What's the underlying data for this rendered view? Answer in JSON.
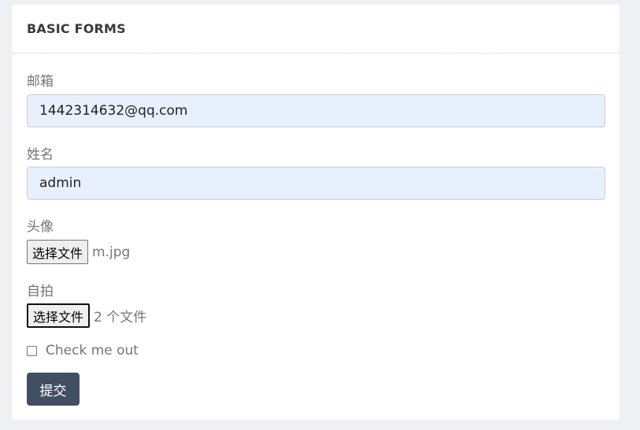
{
  "card": {
    "title": "BASIC FORMS"
  },
  "form": {
    "email": {
      "label": "邮箱",
      "value": "1442314632@qq.com"
    },
    "name": {
      "label": "姓名",
      "value": "admin"
    },
    "avatar": {
      "label": "头像",
      "button_label": "选择文件",
      "file_status": "m.jpg"
    },
    "selfie": {
      "label": "自拍",
      "button_label": "选择文件",
      "file_status": "2 个文件"
    },
    "checkbox": {
      "label": "Check me out",
      "checked": false
    },
    "submit_label": "提交"
  },
  "colors": {
    "background": "#eff0f4",
    "card": "#ffffff",
    "input_fill": "#e8f0fe",
    "submit_button": "#424f63",
    "label_text": "#767676"
  }
}
